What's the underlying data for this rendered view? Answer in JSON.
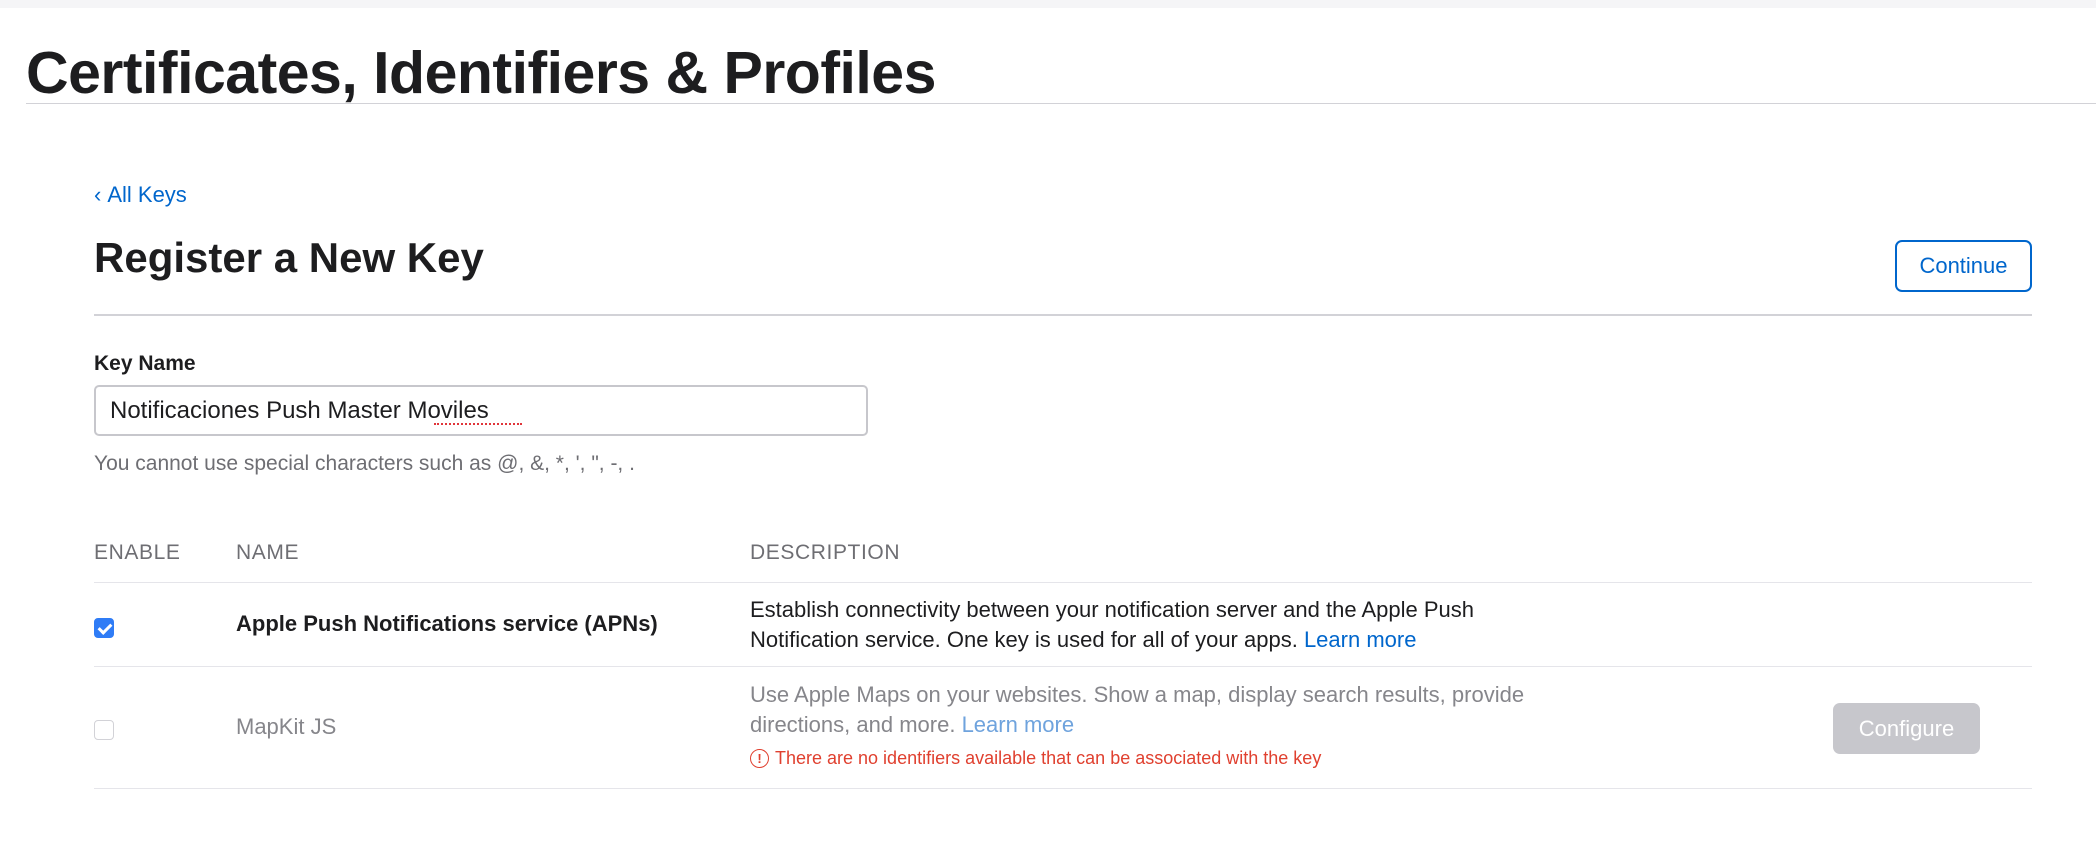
{
  "header": {
    "title": "Certificates, Identifiers & Profiles"
  },
  "nav": {
    "back_chevron": "‹",
    "back_label": "All Keys"
  },
  "form": {
    "section_title": "Register a New Key",
    "continue_label": "Continue",
    "key_name_label": "Key Name",
    "key_name_value": "Notificaciones Push Master Moviles",
    "key_name_helper": "You cannot use special characters such as @, &, *, ', \", -, ."
  },
  "table": {
    "columns": [
      "ENABLE",
      "NAME",
      "DESCRIPTION"
    ],
    "rows": [
      {
        "enabled": true,
        "name": "Apple Push Notifications service (APNs)",
        "description": "Establish connectivity between your notification server and the Apple Push Notification service. One key is used for all of your apps.",
        "learn_more": "Learn more"
      },
      {
        "enabled": false,
        "name": "MapKit JS",
        "description": "Use Apple Maps on your websites. Show a map, display search results, provide directions, and more.",
        "learn_more": "Learn more",
        "warning_icon": "!",
        "warning": "There are no identifiers available that can be associated with the key",
        "configure_label": "Configure"
      }
    ]
  },
  "colors": {
    "accent": "#0066cc",
    "checkbox": "#2f7cf6",
    "error": "#e0402f",
    "disabled_button": "#c7c7cc"
  }
}
